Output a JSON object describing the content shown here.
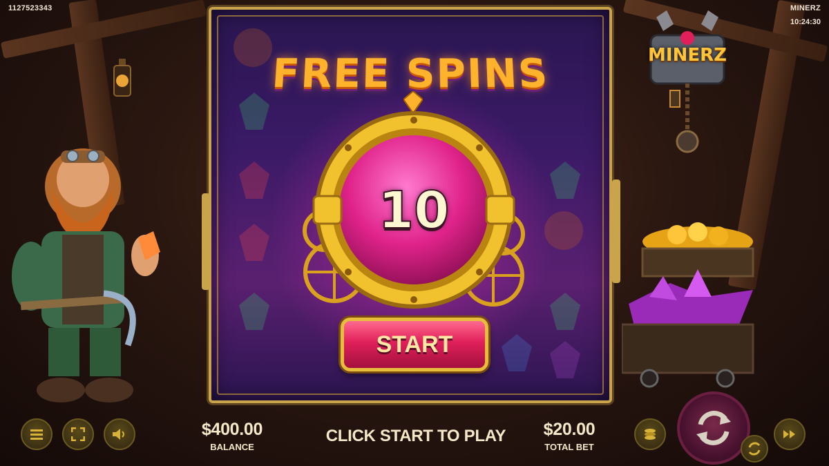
{
  "top": {
    "session_id": "1127523343",
    "game_name": "MINERZ",
    "clock": "10:24:30"
  },
  "logo": {
    "text": "MINERZ"
  },
  "popup": {
    "title": "FREE SPINS",
    "spins_count": "10",
    "start_label": "START"
  },
  "bottom": {
    "balance_value": "$400.00",
    "balance_label": "BALANCE",
    "message": "CLICK START TO PLAY",
    "total_bet_value": "$20.00",
    "total_bet_label": "TOTAL BET"
  },
  "icons": {
    "menu": "menu-icon",
    "fullscreen": "fullscreen-icon",
    "sound": "sound-icon",
    "coins": "coins-icon",
    "spin": "spin-icon",
    "autoplay": "autoplay-icon",
    "turbo": "fast-forward-icon"
  },
  "colors": {
    "title_orange": "#ffb22b",
    "start_pink": "#e0205a",
    "frame_gold": "#c9a44a",
    "text_cream": "#f4e8c8"
  }
}
